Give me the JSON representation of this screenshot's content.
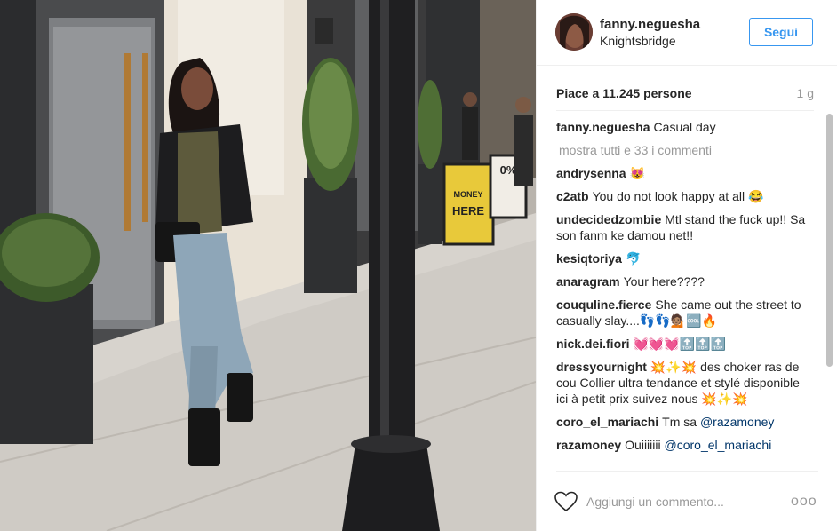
{
  "post": {
    "username": "fanny.neguesha",
    "location": "Knightsbridge",
    "follow_label": "Segui",
    "likes": "Piace a 11.245 persone",
    "age": "1 g"
  },
  "caption": {
    "user": "fanny.neguesha",
    "text": "Casual day"
  },
  "show_all": "mostra tutti e 33 i commenti",
  "comments": [
    {
      "user": "andrysenna",
      "text": "😻"
    },
    {
      "user": "c2atb",
      "text": "You do not look happy at all 😂"
    },
    {
      "user": "undecidedzombie",
      "text": "Mtl stand the fuck up!! Sa son fanm ke damou net!!"
    },
    {
      "user": "kesiqtoriya",
      "text": "🐬"
    },
    {
      "user": "anaragram",
      "text": "Your here????"
    },
    {
      "user": "couquline.fierce",
      "text": "She came out the street to casually slay....👣👣💁🏽🆒🔥"
    },
    {
      "user": "nick.dei.fiori",
      "text": "💓💓💓🔝🔝🔝"
    },
    {
      "user": "dressyournight",
      "text": "💥✨💥 des choker ras de cou Collier ultra tendance et stylé disponible ici à petit prix suivez nous 💥✨💥"
    },
    {
      "user": "coro_el_mariachi",
      "text": "Tm sa ",
      "mention": "@razamoney"
    },
    {
      "user": "razamoney",
      "text": "Ouiiiiiii ",
      "mention": "@coro_el_mariachi"
    }
  ],
  "footer": {
    "comment_placeholder": "Aggiungi un commento...",
    "more_label": "ooo"
  },
  "photo_signs": {
    "sign1_lines": [
      "MONEY",
      "HERE"
    ],
    "sign2_lines": [
      "0%"
    ]
  },
  "colors": {
    "accent": "#3897f0",
    "text": "#262626",
    "muted": "#999999",
    "border": "#efefef"
  }
}
